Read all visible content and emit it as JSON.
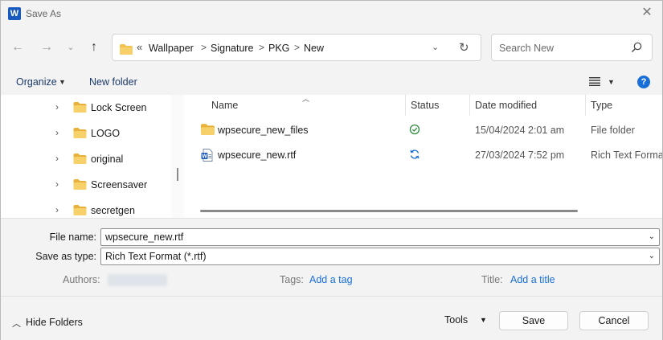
{
  "window": {
    "title": "Save As",
    "app_icon": "W"
  },
  "nav": {
    "breadcrumb_prefix": "«",
    "breadcrumbs": [
      "Wallpaper",
      "Signature",
      "PKG",
      "New"
    ],
    "separator": ">",
    "search_placeholder": "Search New"
  },
  "toolbar": {
    "organize_label": "Organize",
    "new_folder_label": "New folder"
  },
  "tree": {
    "items": [
      {
        "label": "Lock Screen"
      },
      {
        "label": "LOGO"
      },
      {
        "label": "original"
      },
      {
        "label": "Screensaver"
      },
      {
        "label": "secretgen"
      }
    ]
  },
  "files": {
    "columns": {
      "name": "Name",
      "status": "Status",
      "date": "Date modified",
      "type": "Type"
    },
    "rows": [
      {
        "name": "wpsecure_new_files",
        "status": "available",
        "date": "15/04/2024 2:01 am",
        "type": "File folder",
        "icon": "folder-icon"
      },
      {
        "name": "wpsecure_new.rtf",
        "status": "sync",
        "date": "27/03/2024 7:52 pm",
        "type": "Rich Text Format",
        "icon": "word-document-icon"
      }
    ]
  },
  "form": {
    "file_name_label": "File name:",
    "file_name_value": "wpsecure_new.rtf",
    "save_type_label": "Save as type:",
    "save_type_value": "Rich Text Format (*.rtf)",
    "authors_label": "Authors:",
    "tags_label": "Tags:",
    "tags_link": "Add a tag",
    "title_label": "Title:",
    "title_link": "Add a title"
  },
  "footer": {
    "hide_folders_label": "Hide Folders",
    "tools_label": "Tools",
    "save_label": "Save",
    "cancel_label": "Cancel"
  },
  "colors": {
    "accent": "#1a6fd6",
    "folder": "#f2c14e",
    "status_ok": "#2e8b3d"
  }
}
